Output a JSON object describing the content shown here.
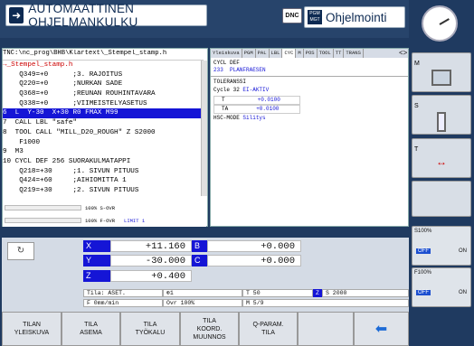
{
  "header": {
    "mode_title": "AUTOMAATTINEN OHJELMANKULKU",
    "dnc": "DNC",
    "pgm_icon": "PGM MGT",
    "pgm_title": "Ohjelmointi"
  },
  "program": {
    "path": "TNC:\\nc_prog\\BHB\\Klartext\\_Stempel_stamp.h",
    "lines": [
      {
        "text": "→_Stempel_stamp.h",
        "kind": "hdr"
      },
      {
        "text": "    Q349=+0      ;3. RAJOITUS",
        "kind": ""
      },
      {
        "text": "    Q220=+0      ;NURKAN SADE",
        "kind": ""
      },
      {
        "text": "    Q368=+0      ;REUNAN ROUHINTAVARA",
        "kind": ""
      },
      {
        "text": "    Q338=+0      ;VIIMEISTELYASETUS",
        "kind": ""
      },
      {
        "text": "6  L  Y-30  X+30 R0 FMAX M99",
        "kind": "sel"
      },
      {
        "text": "7  CALL LBL \"safe\"",
        "kind": ""
      },
      {
        "text": "8  TOOL CALL \"MILL_D20_ROUGH\" Z S2000",
        "kind": ""
      },
      {
        "text": "    F1000",
        "kind": ""
      },
      {
        "text": "9  M3",
        "kind": ""
      },
      {
        "text": "10 CYCL DEF 256 SUORAKULMATAPPI",
        "kind": ""
      },
      {
        "text": "    Q218=+30     ;1. SIVUN PITUUS",
        "kind": ""
      },
      {
        "text": "    Q424=+60     ;AIHIOMITTA 1",
        "kind": ""
      },
      {
        "text": "    Q219=+30     ;2. SIVUN PITUUS",
        "kind": ""
      }
    ],
    "s_ovr": "100% S-OVR",
    "f_ovr": "100% F-OVR",
    "limit": "LIMIT 1"
  },
  "status": {
    "tabs": [
      "Yleiskuva",
      "PGM",
      "PAL",
      "LBL",
      "CYC",
      "M",
      "POS",
      "TOOL",
      "TT",
      "TRANS"
    ],
    "active_tab": "CYC",
    "cycl_def_label": "CYCL DEF",
    "cycl_def_value": "233  PLANFRAESEN",
    "tol_label": "TOLERANSSI",
    "cycle32": "Cycle 32",
    "cycle32_value": "EI-AKTIV",
    "t_label": "T",
    "t_value": "+0.0100",
    "ta_label": "TA",
    "ta_value": "+0.0100",
    "hsc_label": "HSC-MODE",
    "hsc_value": "Silitys"
  },
  "position": {
    "x_label": "X",
    "x_value": "+11.160",
    "b_label": "B",
    "b_value": "+0.000",
    "y_label": "Y",
    "y_value": "-30.000",
    "c_label": "C",
    "c_value": "+0.000",
    "z_label": "Z",
    "z_value": "+0.400",
    "tila": "Tila: ASET.",
    "tila_icon": "1",
    "tool": "T 50",
    "z_axis": "Z",
    "spindle": "S 2000",
    "feed": "F 0mm/min",
    "ovr": "Ovr 100%",
    "m": "M 5/9"
  },
  "softkeys": [
    {
      "l1": "TILAN",
      "l2": "YLEISKUVA"
    },
    {
      "l1": "TILA",
      "l2": "ASEMA"
    },
    {
      "l1": "TILA",
      "l2": "TYÖKALU"
    },
    {
      "l1": "TILA",
      "l2": "KOORD.",
      "l3": "MUUNNOS"
    },
    {
      "l1": "Q-PARAM.",
      "l2": "TILA"
    }
  ],
  "vertical": {
    "s_pct": "S100%",
    "f_pct": "F100%",
    "off1": "OFF",
    "on1": "ON",
    "off2": "OFF",
    "on2": "ON",
    "m": "M",
    "s": "S",
    "t": "T"
  },
  "colors": {
    "accent": "#1515d6",
    "background": "#1f3a60"
  }
}
